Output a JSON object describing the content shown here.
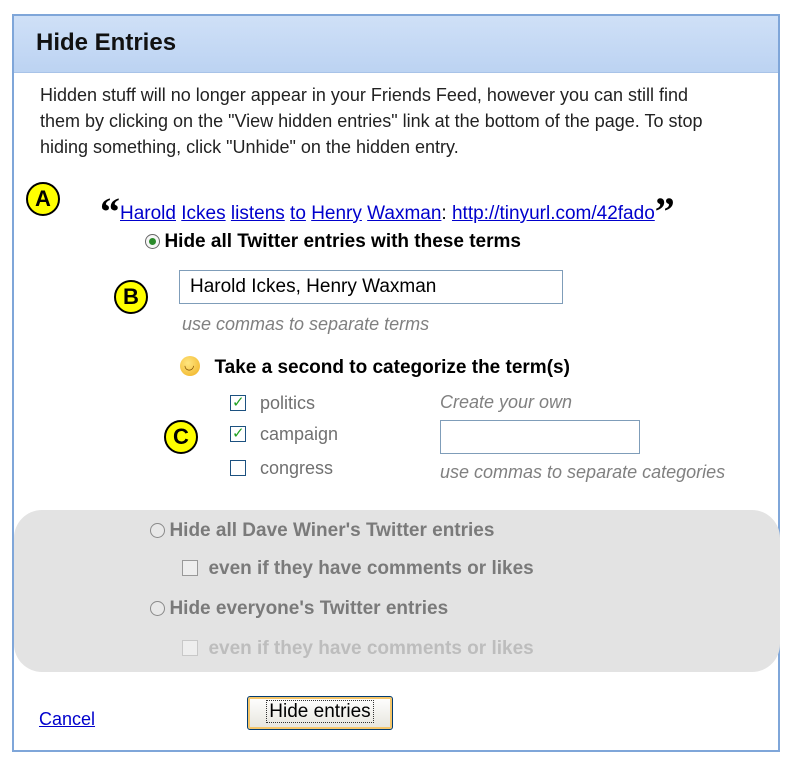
{
  "dialog": {
    "title": "Hide Entries",
    "intro": "Hidden stuff will no longer appear in your Friends Feed, however you can still find them by clicking on the \"View hidden entries\" link at the bottom of the page. To stop hiding something, click \"Unhide\" on the hidden entry."
  },
  "markers": {
    "a": "A",
    "b": "B",
    "c": "C"
  },
  "entry": {
    "open_quote": "“",
    "close_quote": "”",
    "words": [
      "Harold",
      "Ickes",
      "listens",
      "to",
      "Henry",
      "Waxman"
    ],
    "colon": ":",
    "link": "http://tinyurl.com/42fado"
  },
  "option_terms": {
    "label": "Hide all Twitter entries with these terms",
    "selected": true,
    "input_value": "Harold Ickes, Henry Waxman",
    "hint": "use commas to separate terms"
  },
  "categorize": {
    "prompt": "Take a second to categorize the term(s)",
    "categories": [
      {
        "label": "politics",
        "checked": true
      },
      {
        "label": "campaign",
        "checked": true
      },
      {
        "label": "congress",
        "checked": false
      }
    ],
    "create_own_label": "Create your own",
    "create_own_value": "",
    "create_own_hint": "use commas to separate categories"
  },
  "option_user": {
    "label": "Hide all Dave Winer's Twitter entries",
    "sub_label": "even if they have comments or likes"
  },
  "option_everyone": {
    "label": "Hide everyone's Twitter entries",
    "sub_label": "even if they have comments or likes"
  },
  "footer": {
    "cancel_label": "Cancel",
    "submit_label": "Hide entries"
  }
}
